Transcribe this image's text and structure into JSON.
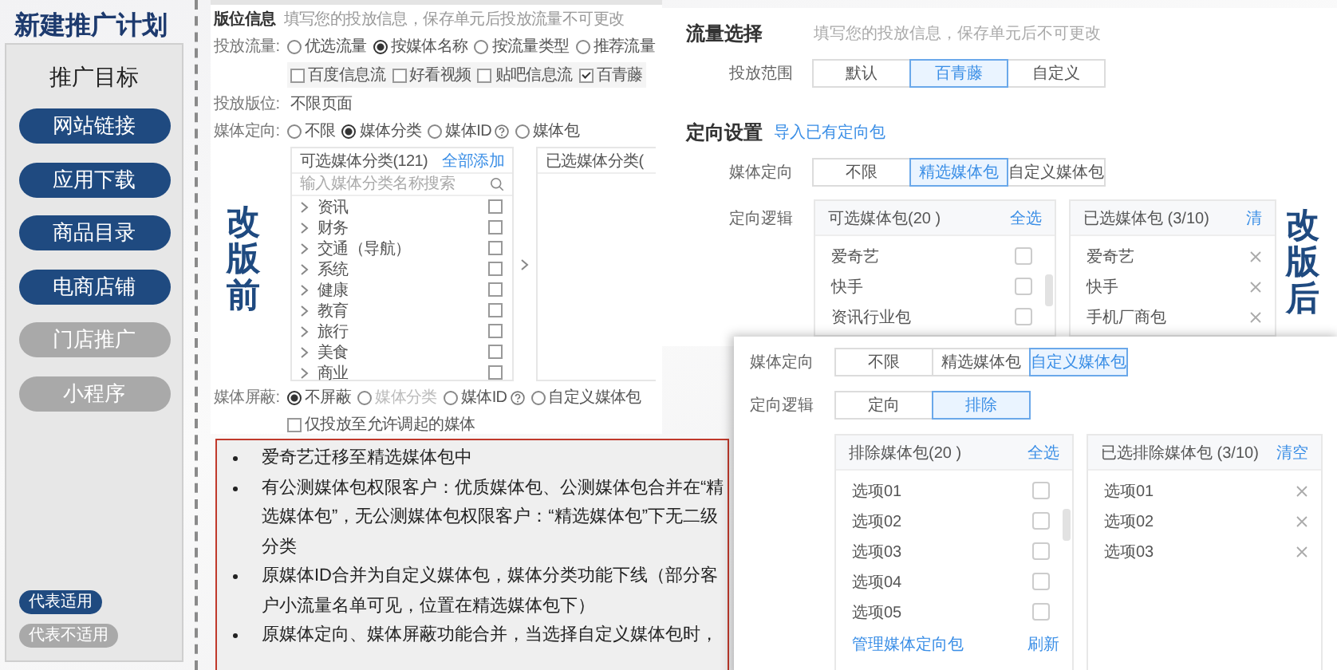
{
  "sidebar": {
    "title": "新建推广计划",
    "heading": "推广目标",
    "goals": [
      {
        "label": "网站链接",
        "applicable": true
      },
      {
        "label": "应用下载",
        "applicable": true
      },
      {
        "label": "商品目录",
        "applicable": true
      },
      {
        "label": "电商店铺",
        "applicable": true
      },
      {
        "label": "门店推广",
        "applicable": false
      },
      {
        "label": "小程序",
        "applicable": false
      }
    ],
    "legend": [
      {
        "label": "代表适用",
        "applicable": true
      },
      {
        "label": "代表不适用",
        "applicable": false
      }
    ]
  },
  "before": {
    "label": "改版前",
    "section_title": "版位信息",
    "section_hint": "填写您的投放信息，保存单元后投放流量不可更改",
    "traffic": {
      "label": "投放流量:",
      "options": [
        {
          "label": "优选流量",
          "selected": false
        },
        {
          "label": "按媒体名称",
          "selected": true
        },
        {
          "label": "按流量类型",
          "selected": false
        },
        {
          "label": "推荐流量",
          "selected": false
        }
      ],
      "channels": [
        {
          "label": "百度信息流",
          "checked": false
        },
        {
          "label": "好看视频",
          "checked": false
        },
        {
          "label": "贴吧信息流",
          "checked": false
        },
        {
          "label": "百青藤",
          "checked": true
        }
      ]
    },
    "placement": {
      "label": "投放版位:",
      "value": "不限页面"
    },
    "media_targeting": {
      "label": "媒体定向:",
      "options": [
        {
          "label": "不限",
          "selected": false,
          "help": false
        },
        {
          "label": "媒体分类",
          "selected": true,
          "help": false
        },
        {
          "label": "媒体ID",
          "selected": false,
          "help": true
        },
        {
          "label": "媒体包",
          "selected": false,
          "help": false
        }
      ]
    },
    "available": {
      "title": "可选媒体分类(121)",
      "action": "全部添加",
      "search_placeholder": "输入媒体分类名称搜索",
      "items": [
        {
          "label": "资讯",
          "checked": false
        },
        {
          "label": "财务",
          "checked": false
        },
        {
          "label": "交通（导航）",
          "checked": false
        },
        {
          "label": "系统",
          "checked": false
        },
        {
          "label": "健康",
          "checked": false
        },
        {
          "label": "教育",
          "checked": false
        },
        {
          "label": "旅行",
          "checked": false
        },
        {
          "label": "美食",
          "checked": false
        },
        {
          "label": "商业",
          "checked": false
        }
      ]
    },
    "chosen": {
      "title": "已选媒体分类("
    },
    "media_block": {
      "label": "媒体屏蔽:",
      "options": [
        {
          "label": "不屏蔽",
          "selected": true,
          "disabled": false,
          "help": false
        },
        {
          "label": "媒体分类",
          "selected": false,
          "disabled": true,
          "help": false
        },
        {
          "label": "媒体ID",
          "selected": false,
          "disabled": false,
          "help": true
        },
        {
          "label": "自定义媒体包",
          "selected": false,
          "disabled": false,
          "help": false
        }
      ]
    },
    "invoke_only": {
      "label": "仅投放至允许调起的媒体",
      "checked": false
    }
  },
  "notes": [
    "爱奇艺迁移至精选媒体包中",
    "有公测媒体包权限客户：优质媒体包、公测媒体包合并在“精选媒体包”，无公测媒体包权限客户：“精选媒体包”下无二级分类",
    "原媒体ID合并为自定义媒体包，媒体分类功能下线（部分客户小流量名单可见，位置在精选媒体包下）",
    "原媒体定向、媒体屏蔽功能合并，当选择自定义媒体包时，"
  ],
  "after": {
    "label": "改版后",
    "traffic": {
      "title": "流量选择",
      "hint": "填写您的投放信息，保存单元后不可更改",
      "scope": {
        "label": "投放范围",
        "options": [
          {
            "label": "默认",
            "selected": false
          },
          {
            "label": "百青藤",
            "selected": true
          },
          {
            "label": "自定义",
            "selected": false
          }
        ]
      }
    },
    "targeting": {
      "title": "定向设置",
      "import_link": "导入已有定向包",
      "media": {
        "label": "媒体定向",
        "options": [
          {
            "label": "不限",
            "selected": false
          },
          {
            "label": "精选媒体包",
            "selected": true
          },
          {
            "label": "自定义媒体包",
            "selected": false
          }
        ]
      },
      "logic_label": "定向逻辑",
      "available": {
        "title": "可选媒体包(20 )",
        "action": "全选",
        "items": [
          {
            "label": "爱奇艺",
            "checked": false
          },
          {
            "label": "快手",
            "checked": false
          },
          {
            "label": "资讯行业包",
            "checked": false
          }
        ]
      },
      "chosen": {
        "title": "已选媒体包 (3/10)",
        "action": "清",
        "items": [
          "爱奇艺",
          "快手",
          "手机厂商包"
        ]
      }
    }
  },
  "custom_dialog": {
    "media": {
      "label": "媒体定向",
      "options": [
        {
          "label": "不限",
          "selected": false
        },
        {
          "label": "精选媒体包",
          "selected": false
        },
        {
          "label": "自定义媒体包",
          "selected": true
        }
      ]
    },
    "logic": {
      "label": "定向逻辑",
      "options": [
        {
          "label": "定向",
          "selected": false
        },
        {
          "label": "排除",
          "selected": true
        }
      ]
    },
    "excluded": {
      "title": "排除媒体包(20 )",
      "action": "全选",
      "items": [
        {
          "label": "选项01",
          "checked": false
        },
        {
          "label": "选项02",
          "checked": false
        },
        {
          "label": "选项03",
          "checked": false
        },
        {
          "label": "选项04",
          "checked": false
        },
        {
          "label": "选项05",
          "checked": false
        }
      ],
      "manage_link": "管理媒体定向包",
      "refresh_link": "刷新"
    },
    "chosen": {
      "title": "已选排除媒体包 (3/10)",
      "action": "清空",
      "items": [
        "选项01",
        "选项02",
        "选项03"
      ]
    }
  }
}
